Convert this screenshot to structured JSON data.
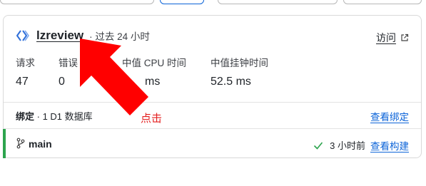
{
  "project": {
    "name": "lzreview",
    "meta": "· 过去 24 小时",
    "visit_label": "访问"
  },
  "metrics": [
    {
      "label": "请求",
      "value": "47"
    },
    {
      "label": "错误",
      "value": "0"
    },
    {
      "label": "中值 CPU 时间",
      "value": "ms"
    },
    {
      "label": "中值挂钟时间",
      "value": "52.5 ms"
    }
  ],
  "binding": {
    "label": "绑定",
    "detail": "· 1 D1 数据库",
    "link": "查看绑定"
  },
  "deployment": {
    "branch": "main",
    "time": "3 小时前",
    "link": "查看构建"
  },
  "annotation": {
    "text": "点击",
    "color": "#e41e1e"
  },
  "colors": {
    "link": "#0b63d8",
    "success": "#2da44e",
    "arrow": "#ff0000"
  }
}
